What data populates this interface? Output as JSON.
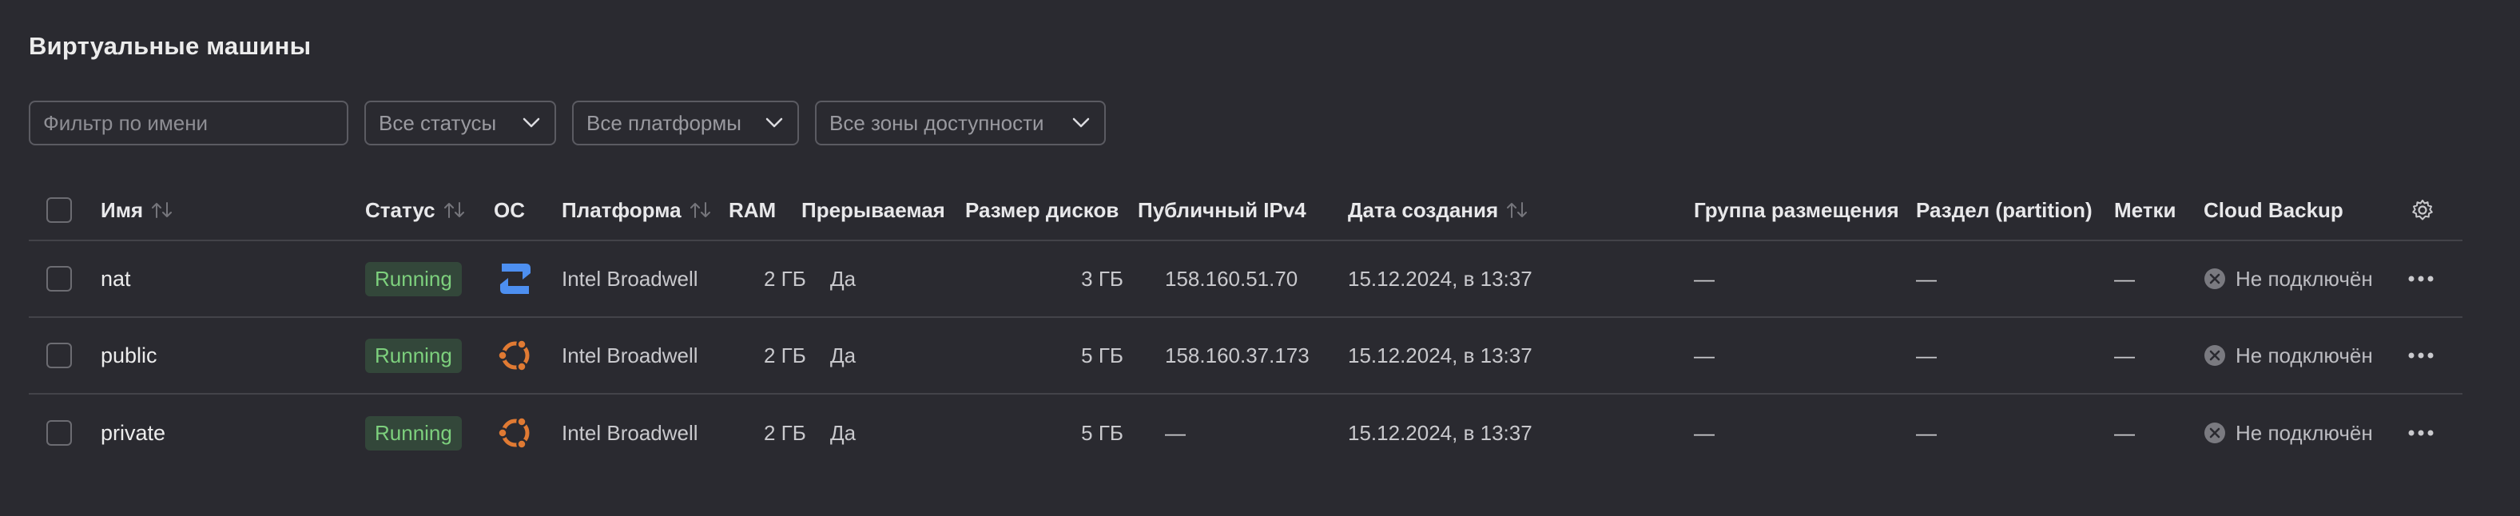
{
  "page": {
    "title": "Виртуальные машины"
  },
  "filters": {
    "name_placeholder": "Фильтр по имени",
    "status_label": "Все статусы",
    "platform_label": "Все платформы",
    "zone_label": "Все зоны доступности"
  },
  "table": {
    "headers": {
      "name": "Имя",
      "status": "Статус",
      "os": "ОС",
      "platform": "Платформа",
      "ram": "RAM",
      "preemptible": "Прерываемая",
      "disk_size": "Размер дисков",
      "public_ipv4": "Публичный IPv4",
      "created": "Дата создания",
      "placement_group": "Группа размещения",
      "partition": "Раздел (partition)",
      "labels": "Метки",
      "cloud_backup": "Cloud Backup"
    },
    "rows": [
      {
        "name": "nat",
        "status": "Running",
        "os": "nat-instance",
        "platform": "Intel Broadwell",
        "ram": "2 ГБ",
        "preemptible": "Да",
        "disk_size": "3 ГБ",
        "public_ipv4": "158.160.51.70",
        "created": "15.12.2024, в 13:37",
        "placement_group": "—",
        "partition": "—",
        "labels": "—",
        "cloud_backup": "Не подключён"
      },
      {
        "name": "public",
        "status": "Running",
        "os": "ubuntu",
        "platform": "Intel Broadwell",
        "ram": "2 ГБ",
        "preemptible": "Да",
        "disk_size": "5 ГБ",
        "public_ipv4": "158.160.37.173",
        "created": "15.12.2024, в 13:37",
        "placement_group": "—",
        "partition": "—",
        "labels": "—",
        "cloud_backup": "Не подключён"
      },
      {
        "name": "private",
        "status": "Running",
        "os": "ubuntu",
        "platform": "Intel Broadwell",
        "ram": "2 ГБ",
        "preemptible": "Да",
        "disk_size": "5 ГБ",
        "public_ipv4": "—",
        "created": "15.12.2024, в 13:37",
        "placement_group": "—",
        "partition": "—",
        "labels": "—",
        "cloud_backup": "Не подключён"
      }
    ]
  },
  "colors": {
    "background": "#2a2a30",
    "running_badge_bg": "#33473a",
    "running_badge_text": "#7dd07d",
    "nat_icon": "#4d8ff0",
    "ubuntu_icon": "#e07a33"
  }
}
